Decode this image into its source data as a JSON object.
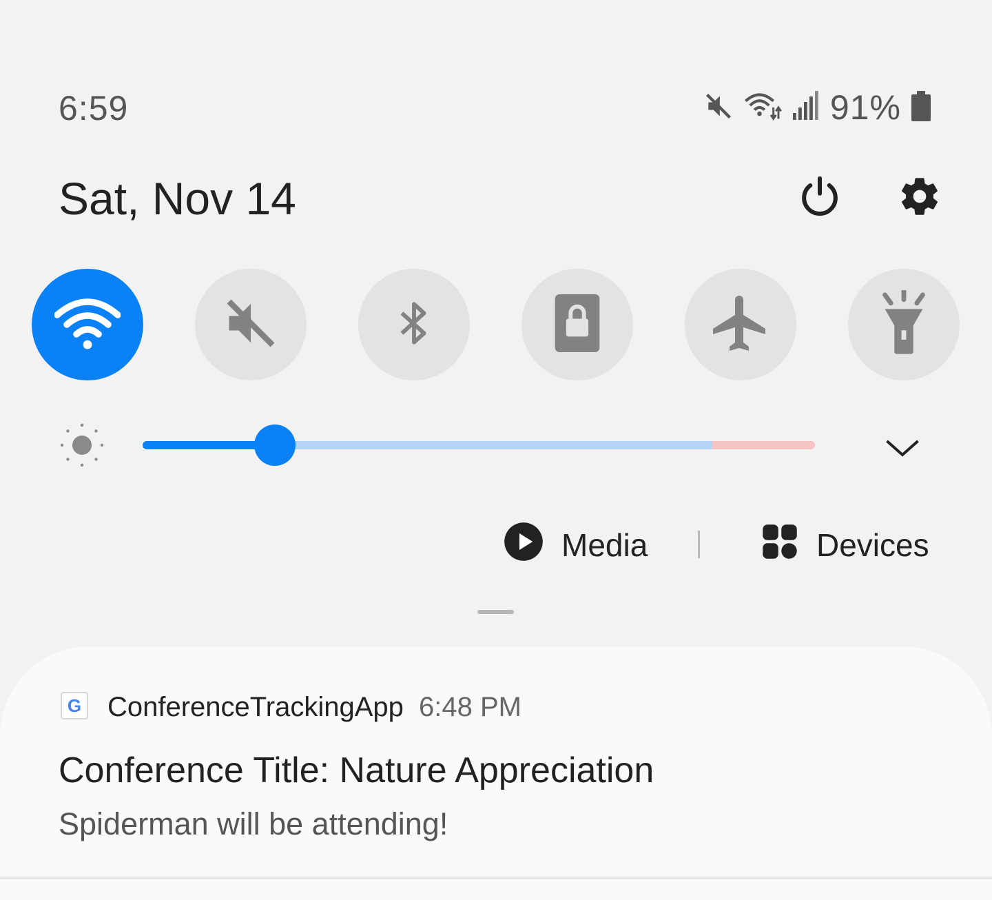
{
  "status_bar": {
    "time": "6:59",
    "battery_percent": "91%",
    "icons": [
      "mute-icon",
      "wifi-data-icon",
      "signal-icon",
      "battery-icon"
    ]
  },
  "header": {
    "date": "Sat, Nov 14",
    "icons": [
      "power-icon",
      "settings-icon"
    ]
  },
  "quick_settings": [
    {
      "name": "wifi",
      "icon": "wifi-icon",
      "active": true
    },
    {
      "name": "sound",
      "icon": "mute-icon",
      "active": false
    },
    {
      "name": "bluetooth",
      "icon": "bluetooth-icon",
      "active": false
    },
    {
      "name": "screen-lock",
      "icon": "lock-icon",
      "active": false
    },
    {
      "name": "airplane-mode",
      "icon": "airplane-icon",
      "active": false
    },
    {
      "name": "flashlight",
      "icon": "flashlight-icon",
      "active": false
    }
  ],
  "brightness": {
    "level": 0.197,
    "warn_from": 0.847
  },
  "controls": {
    "media_label": "Media",
    "devices_label": "Devices"
  },
  "notification": {
    "app_icon_letter": "G",
    "app_name": "ConferenceTrackingApp",
    "time": "6:48 PM",
    "title": "Conference Title: Nature Appreciation",
    "body": "Spiderman will be attending!"
  },
  "colors": {
    "accent": "#0a81f5",
    "toggle_off": "#e3e3e3",
    "background": "#f2f2f2"
  }
}
